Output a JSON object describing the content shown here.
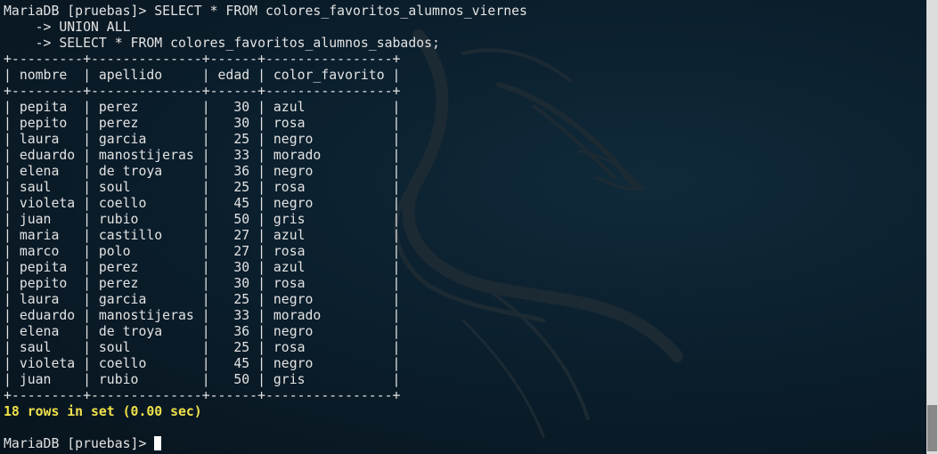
{
  "terminal": {
    "command": [
      "MariaDB [pruebas]> SELECT * FROM colores_favoritos_alumnos_viernes",
      "    -> UNION ALL",
      "    -> SELECT * FROM colores_favoritos_alumnos_sabados;"
    ],
    "table": {
      "border": "+---------+--------------+------+----------------+",
      "columns": [
        "nombre",
        "apellido",
        "edad",
        "color_favorito"
      ],
      "header_line": "| nombre  | apellido     | edad | color_favorito |",
      "rows": [
        [
          "pepita",
          "perez",
          "30",
          "azul"
        ],
        [
          "pepito",
          "perez",
          "30",
          "rosa"
        ],
        [
          "laura",
          "garcia",
          "25",
          "negro"
        ],
        [
          "eduardo",
          "manostijeras",
          "33",
          "morado"
        ],
        [
          "elena",
          "de troya",
          "36",
          "negro"
        ],
        [
          "saul",
          "soul",
          "25",
          "rosa"
        ],
        [
          "violeta",
          "coello",
          "45",
          "negro"
        ],
        [
          "juan",
          "rubio",
          "50",
          "gris"
        ],
        [
          "maria",
          "castillo",
          "27",
          "azul"
        ],
        [
          "marco",
          "polo",
          "27",
          "rosa"
        ],
        [
          "pepita",
          "perez",
          "30",
          "azul"
        ],
        [
          "pepito",
          "perez",
          "30",
          "rosa"
        ],
        [
          "laura",
          "garcia",
          "25",
          "negro"
        ],
        [
          "eduardo",
          "manostijeras",
          "33",
          "morado"
        ],
        [
          "elena",
          "de troya",
          "36",
          "negro"
        ],
        [
          "saul",
          "soul",
          "25",
          "rosa"
        ],
        [
          "violeta",
          "coello",
          "45",
          "negro"
        ],
        [
          "juan",
          "rubio",
          "50",
          "gris"
        ]
      ]
    },
    "summary": "18 rows in set (0.00 sec)",
    "prompt": "MariaDB [pruebas]> "
  },
  "colors": {
    "text": "#e3e3e3",
    "summary": "#f0e14a",
    "background": "#0c1a26"
  }
}
